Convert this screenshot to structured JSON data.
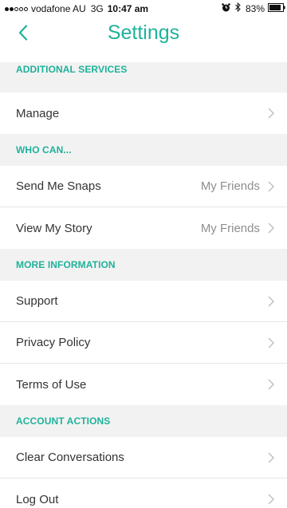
{
  "status_bar": {
    "carrier": "vodafone AU",
    "network": "3G",
    "time": "10:47 am",
    "battery": "83%"
  },
  "nav": {
    "title": "Settings"
  },
  "sections": [
    {
      "header": "ADDITIONAL SERVICES",
      "rows": [
        {
          "label": "Manage",
          "value": ""
        }
      ]
    },
    {
      "header": "WHO CAN...",
      "rows": [
        {
          "label": "Send Me Snaps",
          "value": "My Friends"
        },
        {
          "label": "View My Story",
          "value": "My Friends"
        }
      ]
    },
    {
      "header": "MORE INFORMATION",
      "rows": [
        {
          "label": "Support",
          "value": ""
        },
        {
          "label": "Privacy Policy",
          "value": ""
        },
        {
          "label": "Terms of Use",
          "value": ""
        }
      ]
    },
    {
      "header": "ACCOUNT ACTIONS",
      "rows": [
        {
          "label": "Clear Conversations",
          "value": ""
        },
        {
          "label": "Log Out",
          "value": ""
        }
      ]
    }
  ],
  "colors": {
    "accent": "#1fb29a",
    "section_bg": "#f2f2f2",
    "text": "#333333",
    "secondary_text": "#8e8e8e"
  },
  "icons": {
    "back": "chevron-left-icon",
    "row_disclosure": "chevron-right-icon",
    "alarm": "alarm-icon",
    "bluetooth": "bluetooth-icon",
    "battery": "battery-icon"
  }
}
